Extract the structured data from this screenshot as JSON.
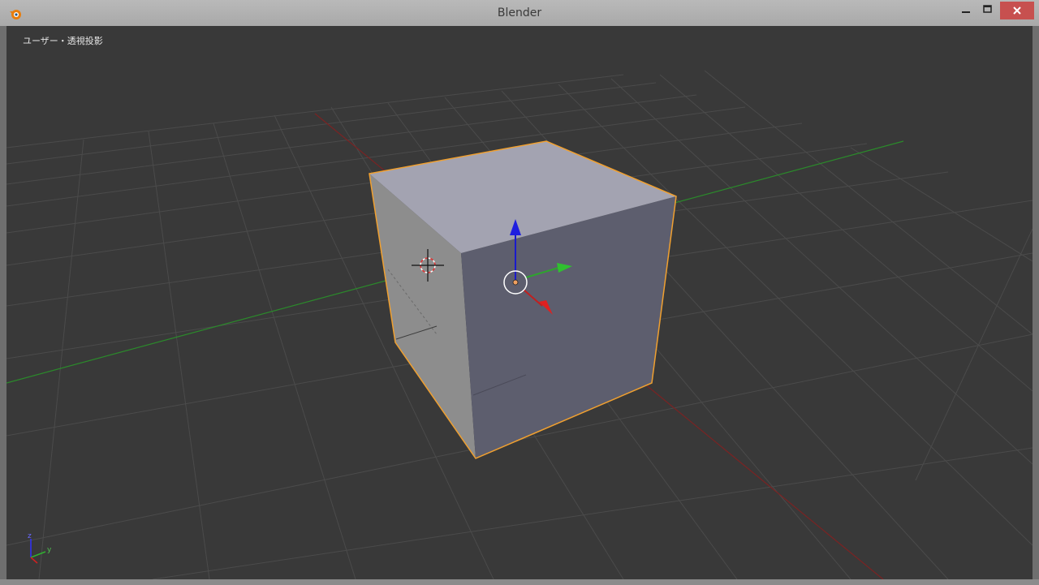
{
  "window": {
    "title": "Blender",
    "app_icon": "blender-logo-icon",
    "controls": [
      "minimize-icon",
      "maximize-icon",
      "close-icon"
    ]
  },
  "viewport": {
    "view_label": "ユーザー・透視投影",
    "axis_gizmo": {
      "z": "z",
      "y": "y"
    }
  },
  "colors": {
    "background": "#393939",
    "grid": "#4e4e4e",
    "x_axis": "#8c2323",
    "y_axis": "#2f8a2f",
    "selection_outline": "#f0a030",
    "cube_top": "#a2a2b0",
    "cube_right": "#5d5e6e",
    "cube_left": "#8c8c8c"
  }
}
